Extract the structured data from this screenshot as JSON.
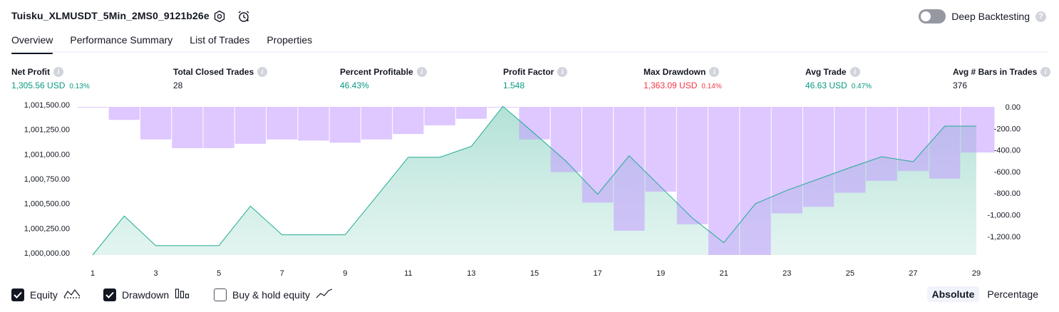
{
  "header": {
    "title": "Tuisku_XLMUSDT_5Min_2MS0_9121b26e",
    "deep_backtesting_label": "Deep Backtesting",
    "deep_backtesting_enabled": false
  },
  "tabs": [
    {
      "label": "Overview",
      "active": true
    },
    {
      "label": "Performance Summary",
      "active": false
    },
    {
      "label": "List of Trades",
      "active": false
    },
    {
      "label": "Properties",
      "active": false
    }
  ],
  "metrics": [
    {
      "label": "Net Profit",
      "value": "1,305.56 USD",
      "pct": "0.13%",
      "color": "green"
    },
    {
      "label": "Total Closed Trades",
      "value": "28",
      "pct": "",
      "color": "dark"
    },
    {
      "label": "Percent Profitable",
      "value": "46.43%",
      "pct": "",
      "color": "green"
    },
    {
      "label": "Profit Factor",
      "value": "1.548",
      "pct": "",
      "color": "green"
    },
    {
      "label": "Max Drawdown",
      "value": "1,363.09 USD",
      "pct": "0.14%",
      "color": "red"
    },
    {
      "label": "Avg Trade",
      "value": "46.63 USD",
      "pct": "0.47%",
      "color": "green"
    },
    {
      "label": "Avg # Bars in Trades",
      "value": "376",
      "pct": "",
      "color": "dark"
    }
  ],
  "chart_data": {
    "type": "line",
    "x": [
      1,
      2,
      3,
      4,
      5,
      6,
      7,
      8,
      9,
      10,
      11,
      12,
      13,
      14,
      15,
      16,
      17,
      18,
      19,
      20,
      21,
      22,
      23,
      24,
      25,
      26,
      27,
      28,
      29
    ],
    "x_tick_labels": [
      "1",
      "3",
      "5",
      "7",
      "9",
      "11",
      "13",
      "15",
      "17",
      "19",
      "21",
      "23",
      "25",
      "27",
      "29"
    ],
    "series": [
      {
        "name": "Equity",
        "axis": "left",
        "color": "#22ab94",
        "values": [
          1000000,
          1000395,
          1000095,
          1000095,
          1000095,
          1000495,
          1000205,
          1000205,
          1000205,
          1000595,
          1000990,
          1000990,
          1001100,
          1001505,
          1001230,
          1000950,
          1000615,
          1001005,
          1000690,
          1000375,
          1000125,
          1000520,
          1000655,
          1000770,
          1000885,
          1000995,
          1000945,
          1001305,
          1001305
        ]
      },
      {
        "name": "Drawdown",
        "axis": "right",
        "color": "#c29aff",
        "values": [
          0,
          -120,
          -300,
          -380,
          -380,
          -340,
          -300,
          -310,
          -330,
          -300,
          -250,
          -170,
          -110,
          0,
          -300,
          -600,
          -880,
          -1140,
          -780,
          -1080,
          -1363,
          -1363,
          -980,
          -920,
          -790,
          -680,
          -590,
          -660,
          -420
        ]
      }
    ],
    "left_axis": {
      "ticks": [
        "1,001,500.00",
        "1,001,250.00",
        "1,001,000.00",
        "1,000,750.00",
        "1,000,500.00",
        "1,000,250.00",
        "1,000,000.00"
      ],
      "ylim": [
        1000000,
        1001500
      ]
    },
    "right_axis": {
      "ticks": [
        "0.00",
        "-200.00",
        "-400.00",
        "-600.00",
        "-800.00",
        "-1,000.00",
        "-1,200.00"
      ],
      "ylim": [
        -1363.09,
        0
      ]
    },
    "grid": false
  },
  "legend": [
    {
      "label": "Equity",
      "checked": true,
      "icon": "equity-line-icon"
    },
    {
      "label": "Drawdown",
      "checked": true,
      "icon": "drawdown-bars-icon"
    },
    {
      "label": "Buy & hold equity",
      "checked": false,
      "icon": "buy-hold-line-icon"
    }
  ],
  "scale_toggle": {
    "options": [
      "Absolute",
      "Percentage"
    ],
    "active": "Absolute"
  }
}
